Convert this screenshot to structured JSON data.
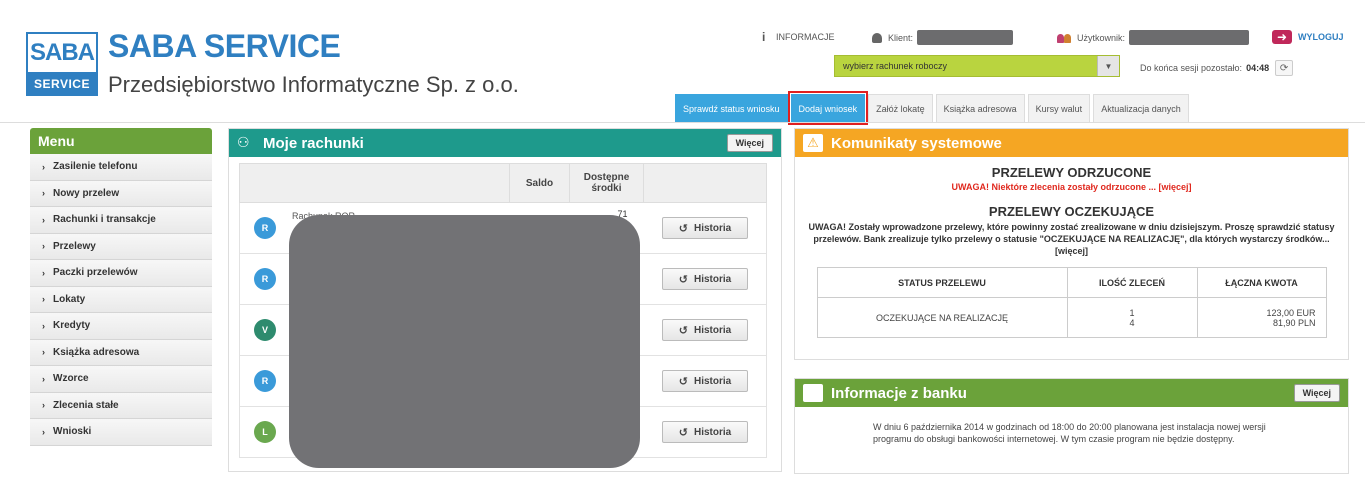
{
  "brand": {
    "logo_top": "SABA",
    "logo_bottom": "SERVICE",
    "title": "SABA SERVICE",
    "subtitle": "Przedsiębiorstwo Informatyczne Sp. z o.o."
  },
  "topbar": {
    "info_label": "INFORMACJE",
    "client_label": "Klient:",
    "user_label": "Użytkownik:",
    "logout_label": "WYLOGUJ",
    "account_select": "wybierz rachunek roboczy",
    "session_label": "Do końca sesji pozostało:",
    "session_time": "04:48",
    "colors": {
      "select_bg": "#b9d43f",
      "logout": "#c0285a"
    }
  },
  "tabs": [
    {
      "label": "Sprawdź status wniosku"
    },
    {
      "label": "Dodaj wniosek"
    },
    {
      "label": "Załóż lokatę"
    },
    {
      "label": "Książka adresowa"
    },
    {
      "label": "Kursy walut"
    },
    {
      "label": "Aktualizacja danych"
    }
  ],
  "menu": {
    "title": "Menu",
    "items": [
      "Zasilenie telefonu",
      "Nowy przelew",
      "Rachunki i transakcje",
      "Przelewy",
      "Paczki przelewów",
      "Lokaty",
      "Kredyty",
      "Książka adresowa",
      "Wzorce",
      "Zlecenia stałe",
      "Wnioski"
    ]
  },
  "accounts": {
    "title": "Moje rachunki",
    "more_label": "Więcej",
    "col_saldo": "Saldo",
    "col_available": "Dostępne środki",
    "history_label": "Historia",
    "first_label": "Rachunek ROR",
    "first_amount_fragment": ".71",
    "rows": [
      {
        "badge": "R",
        "color": "#3a9ad9"
      },
      {
        "badge": "R",
        "color": "#3a9ad9"
      },
      {
        "badge": "V",
        "color": "#2e8b6e"
      },
      {
        "badge": "R",
        "color": "#3a9ad9"
      },
      {
        "badge": "L",
        "color": "#6aa84f"
      }
    ]
  },
  "system_messages": {
    "title": "Komunikaty systemowe",
    "rejected_title": "PRZELEWY ODRZUCONE",
    "rejected_warning": "UWAGA! Niektóre zlecenia zostały odrzucone ... [więcej]",
    "pending_title": "PRZELEWY OCZEKUJĄCE",
    "pending_text": "UWAGA! Zostały wprowadzone przelewy, które powinny zostać zrealizowane w dniu dzisiejszym. Proszę sprawdzić statusy przelewów. Bank zrealizuje tylko przelewy o statusie \"OCZEKUJĄCE NA REALIZACJĘ\", dla których wystarczy środków... [więcej]",
    "table_headers": [
      "STATUS PRZELEWU",
      "ILOŚĆ ZLECEŃ",
      "ŁĄCZNA KWOTA"
    ],
    "table_row": {
      "status": "OCZEKUJĄCE NA REALIZACJĘ",
      "count_1": "1",
      "count_2": "4",
      "amount_1": "123,00 EUR",
      "amount_2": "81,90 PLN"
    },
    "header_color": "#f5a623"
  },
  "bank_info": {
    "title": "Informacje z banku",
    "more_label": "Więcej",
    "text": "W dniu 6 października 2014 w godzinach od 18:00 do 20:00 planowana jest instalacja nowej wersji programu do obsługi bankowości internetowej. W tym czasie program nie będzie dostępny.",
    "header_color": "#6ba23a"
  }
}
